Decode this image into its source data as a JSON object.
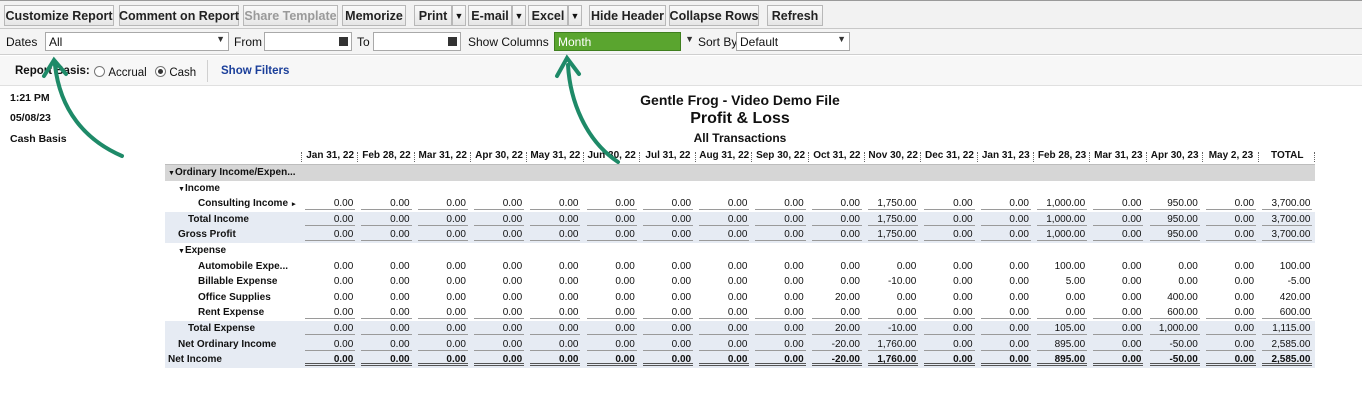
{
  "toolbar": {
    "customize": "Customize Report",
    "comment": "Comment on Report",
    "share": "Share Template",
    "memorize": "Memorize",
    "print": "Print",
    "email": "E-mail",
    "excel": "Excel",
    "hide_header": "Hide Header",
    "collapse_rows": "Collapse Rows",
    "refresh": "Refresh",
    "dropdown_glyph": "▼"
  },
  "filters": {
    "dates_label": "Dates",
    "dates_value": "All",
    "from_label": "From",
    "from_value": "",
    "to_label": "To",
    "to_value": "",
    "show_columns_label": "Show Columns",
    "show_columns_value": "Month",
    "sort_by_label": "Sort By",
    "sort_by_value": "Default"
  },
  "basis": {
    "label": "Report Basis:",
    "accrual": "Accrual",
    "cash": "Cash",
    "selected": "Cash",
    "show_filters": "Show Filters"
  },
  "meta": {
    "time": "1:21 PM",
    "date": "05/08/23",
    "basis": "Cash Basis"
  },
  "report": {
    "company": "Gentle Frog - Video Demo File",
    "title": "Profit & Loss",
    "subtitle": "All Transactions"
  },
  "columns": [
    "Jan 31, 22",
    "Feb 28, 22",
    "Mar 31, 22",
    "Apr 30, 22",
    "May 31, 22",
    "Jun 30, 22",
    "Jul 31, 22",
    "Aug 31, 22",
    "Sep 30, 22",
    "Oct 31, 22",
    "Nov 30, 22",
    "Dec 31, 22",
    "Jan 31, 23",
    "Feb 28, 23",
    "Mar 31, 23",
    "Apr 30, 23",
    "May 2, 23",
    "TOTAL"
  ],
  "rows": [
    {
      "label": "Ordinary Income/Expen...",
      "caret": "▼",
      "indent": 0,
      "style": "grey",
      "values": null
    },
    {
      "label": "Income",
      "caret": "▼",
      "indent": 1,
      "style": "plain",
      "values": null
    },
    {
      "label": "Consulting Income",
      "caret": "▸",
      "indent": 3,
      "style": "detail-first",
      "values": [
        "0.00",
        "0.00",
        "0.00",
        "0.00",
        "0.00",
        "0.00",
        "0.00",
        "0.00",
        "0.00",
        "0.00",
        "1,750.00",
        "0.00",
        "0.00",
        "1,000.00",
        "0.00",
        "950.00",
        "0.00",
        "3,700.00"
      ]
    },
    {
      "label": "Total Income",
      "indent": 2,
      "style": "shade",
      "values": [
        "0.00",
        "0.00",
        "0.00",
        "0.00",
        "0.00",
        "0.00",
        "0.00",
        "0.00",
        "0.00",
        "0.00",
        "1,750.00",
        "0.00",
        "0.00",
        "1,000.00",
        "0.00",
        "950.00",
        "0.00",
        "3,700.00"
      ]
    },
    {
      "label": "Gross Profit",
      "indent": 1,
      "style": "shade",
      "values": [
        "0.00",
        "0.00",
        "0.00",
        "0.00",
        "0.00",
        "0.00",
        "0.00",
        "0.00",
        "0.00",
        "0.00",
        "1,750.00",
        "0.00",
        "0.00",
        "1,000.00",
        "0.00",
        "950.00",
        "0.00",
        "3,700.00"
      ]
    },
    {
      "label": "Expense",
      "caret": "▼",
      "indent": 1,
      "style": "plain",
      "values": null
    },
    {
      "label": "Automobile Expe...",
      "indent": 3,
      "style": "nobar",
      "values": [
        "0.00",
        "0.00",
        "0.00",
        "0.00",
        "0.00",
        "0.00",
        "0.00",
        "0.00",
        "0.00",
        "0.00",
        "0.00",
        "0.00",
        "0.00",
        "100.00",
        "0.00",
        "0.00",
        "0.00",
        "100.00"
      ]
    },
    {
      "label": "Billable Expense",
      "indent": 3,
      "style": "nobar",
      "values": [
        "0.00",
        "0.00",
        "0.00",
        "0.00",
        "0.00",
        "0.00",
        "0.00",
        "0.00",
        "0.00",
        "0.00",
        "-10.00",
        "0.00",
        "0.00",
        "5.00",
        "0.00",
        "0.00",
        "0.00",
        "-5.00"
      ]
    },
    {
      "label": "Office Supplies",
      "indent": 3,
      "style": "nobar",
      "values": [
        "0.00",
        "0.00",
        "0.00",
        "0.00",
        "0.00",
        "0.00",
        "0.00",
        "0.00",
        "0.00",
        "20.00",
        "0.00",
        "0.00",
        "0.00",
        "0.00",
        "0.00",
        "400.00",
        "0.00",
        "420.00"
      ]
    },
    {
      "label": "Rent Expense",
      "indent": 3,
      "style": "bar",
      "values": [
        "0.00",
        "0.00",
        "0.00",
        "0.00",
        "0.00",
        "0.00",
        "0.00",
        "0.00",
        "0.00",
        "0.00",
        "0.00",
        "0.00",
        "0.00",
        "0.00",
        "0.00",
        "600.00",
        "0.00",
        "600.00"
      ]
    },
    {
      "label": "Total Expense",
      "indent": 2,
      "style": "shade",
      "values": [
        "0.00",
        "0.00",
        "0.00",
        "0.00",
        "0.00",
        "0.00",
        "0.00",
        "0.00",
        "0.00",
        "20.00",
        "-10.00",
        "0.00",
        "0.00",
        "105.00",
        "0.00",
        "1,000.00",
        "0.00",
        "1,115.00"
      ]
    },
    {
      "label": "Net Ordinary Income",
      "indent": 1,
      "style": "shade",
      "values": [
        "0.00",
        "0.00",
        "0.00",
        "0.00",
        "0.00",
        "0.00",
        "0.00",
        "0.00",
        "0.00",
        "-20.00",
        "1,760.00",
        "0.00",
        "0.00",
        "895.00",
        "0.00",
        "-50.00",
        "0.00",
        "2,585.00"
      ]
    },
    {
      "label": "Net Income",
      "indent": 0,
      "style": "net",
      "values": [
        "0.00",
        "0.00",
        "0.00",
        "0.00",
        "0.00",
        "0.00",
        "0.00",
        "0.00",
        "0.00",
        "-20.00",
        "1,760.00",
        "0.00",
        "0.00",
        "895.00",
        "0.00",
        "-50.00",
        "0.00",
        "2,585.00"
      ]
    }
  ],
  "colors": {
    "annotation_arrow": "#1e8a68",
    "show_columns_bg": "#5aa52f",
    "link": "#1b3f9a",
    "total_row_bg": "#e6ebf3"
  },
  "icons": [
    "dropdown-arrow-icon",
    "calendar-icon",
    "annotation-arrow-icon",
    "collapse-caret-icon",
    "expand-caret-icon"
  ]
}
